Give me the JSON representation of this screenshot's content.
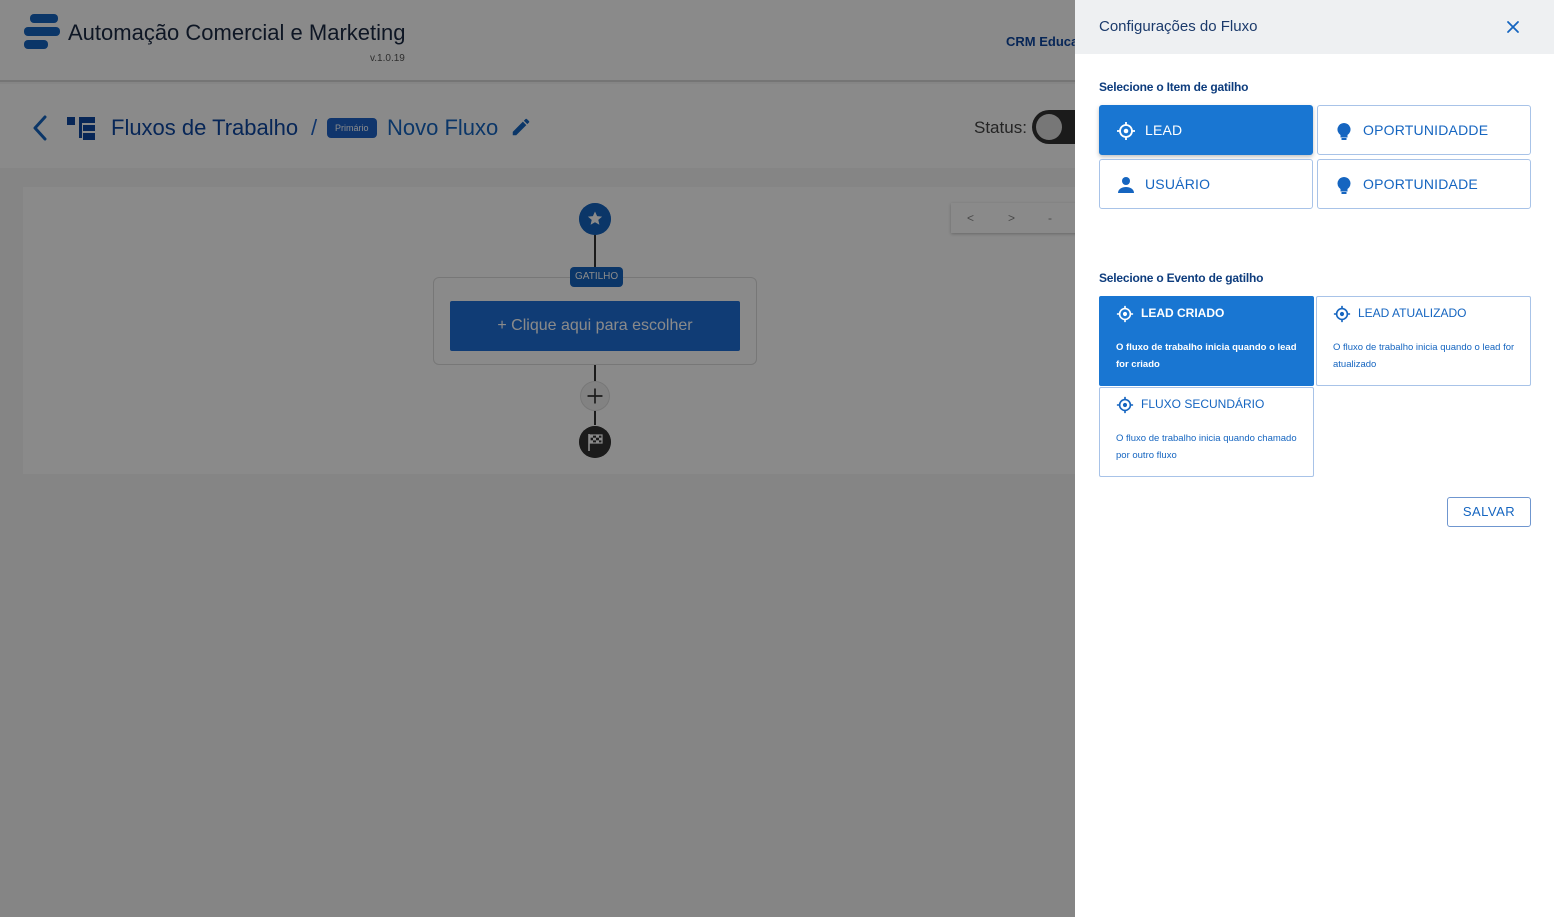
{
  "header": {
    "app_title": "Automação Comercial e Marketing",
    "version": "v.1.0.19",
    "crm_link": "CRM Educac"
  },
  "breadcrumb": {
    "section": "Fluxos de Trabalho",
    "separator": "/",
    "badge": "Primário",
    "flow_name": "Novo Fluxo",
    "status_label": "Status:",
    "status_on": false
  },
  "canvas": {
    "gatilho_badge": "GATILHO",
    "choose_label": "+ Clique aqui para escolher",
    "nav_controls": [
      "<",
      ">",
      "-"
    ]
  },
  "drawer": {
    "title": "Configurações do Fluxo",
    "item_section_label": "Selecione o Item de gatilho",
    "items": [
      {
        "label": "LEAD",
        "icon": "crosshair-icon",
        "active": true
      },
      {
        "label": "OPORTUNIDADDE",
        "icon": "lightbulb-icon",
        "active": false
      },
      {
        "label": "USUÁRIO",
        "icon": "person-icon",
        "active": false
      },
      {
        "label": "OPORTUNIDADE",
        "icon": "lightbulb-icon",
        "active": false
      }
    ],
    "event_section_label": "Selecione o Evento de gatilho",
    "events": [
      {
        "title": "LEAD CRIADO",
        "desc": "O fluxo de trabalho inicia quando o lead for criado",
        "active": true
      },
      {
        "title": "LEAD ATUALIZADO",
        "desc": "O fluxo de trabalho inicia quando o lead for atualizado",
        "active": false
      },
      {
        "title": "FLUXO SECUNDÁRIO",
        "desc": "O fluxo de trabalho inicia quando chamado por outro fluxo",
        "active": false
      }
    ],
    "save_label": "SALVAR"
  },
  "colors": {
    "primary": "#1976d2",
    "primary_dark": "#0d47a1",
    "overlay": "rgba(0,0,0,0.46)"
  }
}
